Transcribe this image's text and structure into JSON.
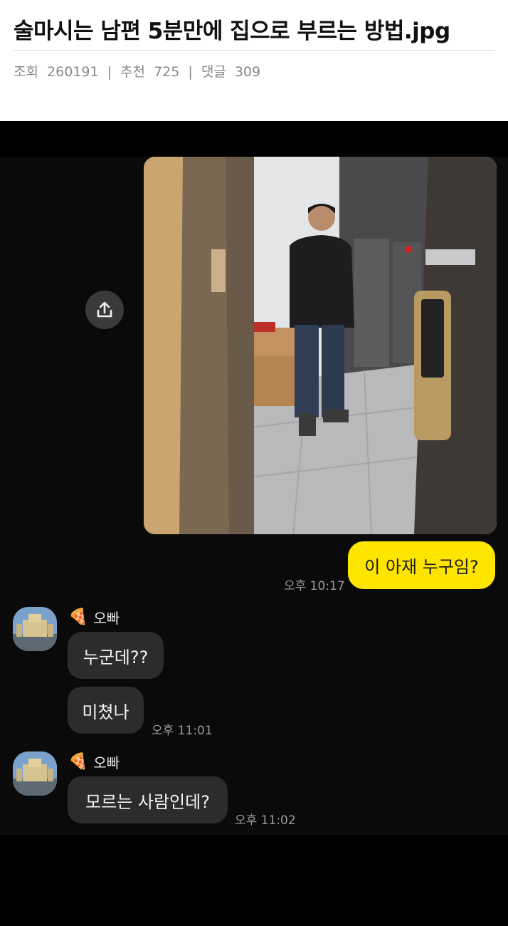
{
  "post": {
    "title": "술마시는 남편 5분만에 집으로 부르는 방법.jpg",
    "meta": {
      "views_label": "조회",
      "views": "260191",
      "likes_label": "추천",
      "likes": "725",
      "comments_label": "댓글",
      "comments": "309",
      "separator": "|"
    }
  },
  "chat": {
    "outgoing": {
      "text": "이 아재 누구임?",
      "time": "오후 10:17"
    },
    "groups": [
      {
        "sender": "오빠",
        "sender_icon": "pizza-icon",
        "messages": [
          {
            "text": "누군데??"
          },
          {
            "text": "미쳤나",
            "time": "오후 11:01"
          }
        ]
      },
      {
        "sender": "오빠",
        "sender_icon": "pizza-icon",
        "messages": [
          {
            "text": "모르는 사람인데?",
            "time": "오후 11:02"
          }
        ]
      }
    ]
  },
  "colors": {
    "outgoing_bubble": "#fee500",
    "incoming_bubble": "#2c2c2e",
    "chat_background": "#0a0a0a"
  }
}
